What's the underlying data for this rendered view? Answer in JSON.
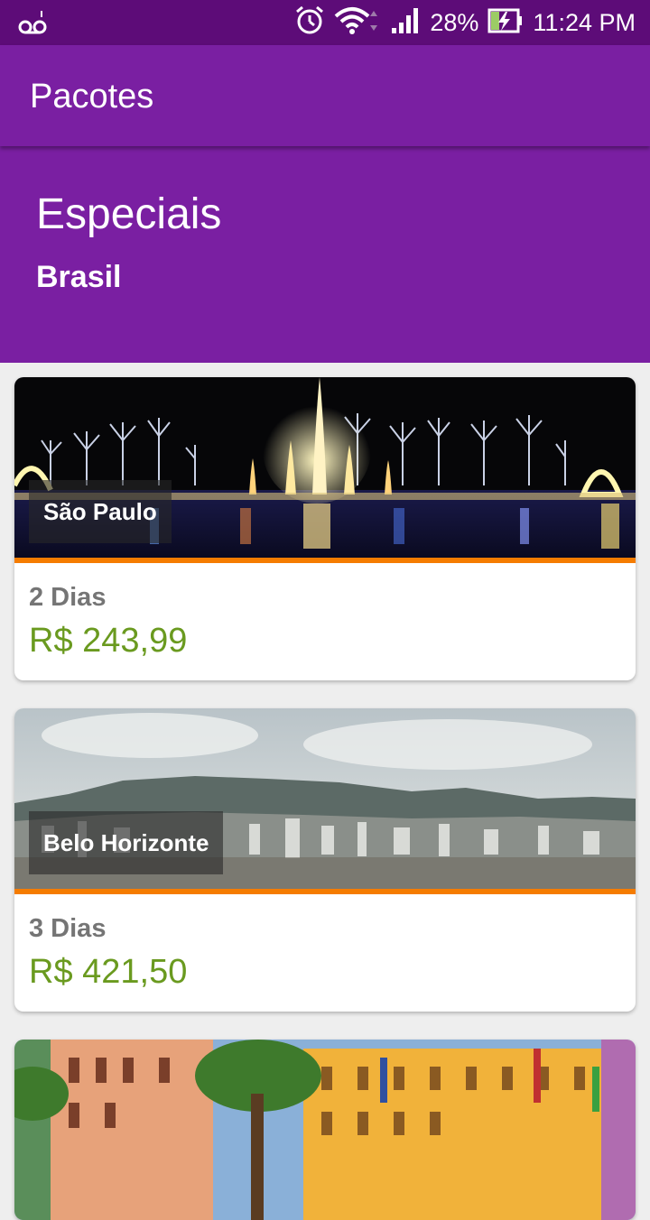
{
  "status_bar": {
    "battery": "28%",
    "time": "11:24 PM",
    "icons": [
      "voicemail-icon",
      "alarm-icon",
      "wifi-icon",
      "signal-icon",
      "battery-charging-icon"
    ]
  },
  "app_bar": {
    "title": "Pacotes"
  },
  "hero": {
    "title": "Especiais",
    "subtitle": "Brasil"
  },
  "packages": [
    {
      "city": "São Paulo",
      "days": "2 Dias",
      "price": "R$ 243,99"
    },
    {
      "city": "Belo Horizonte",
      "days": "3 Dias",
      "price": "R$ 421,50"
    },
    {
      "city": "",
      "days": "",
      "price": ""
    }
  ],
  "colors": {
    "status_bar": "#5d0c78",
    "primary": "#7a1fa2",
    "accent": "#f57c00",
    "price": "#6a9a1f",
    "background": "#eeeeee"
  }
}
